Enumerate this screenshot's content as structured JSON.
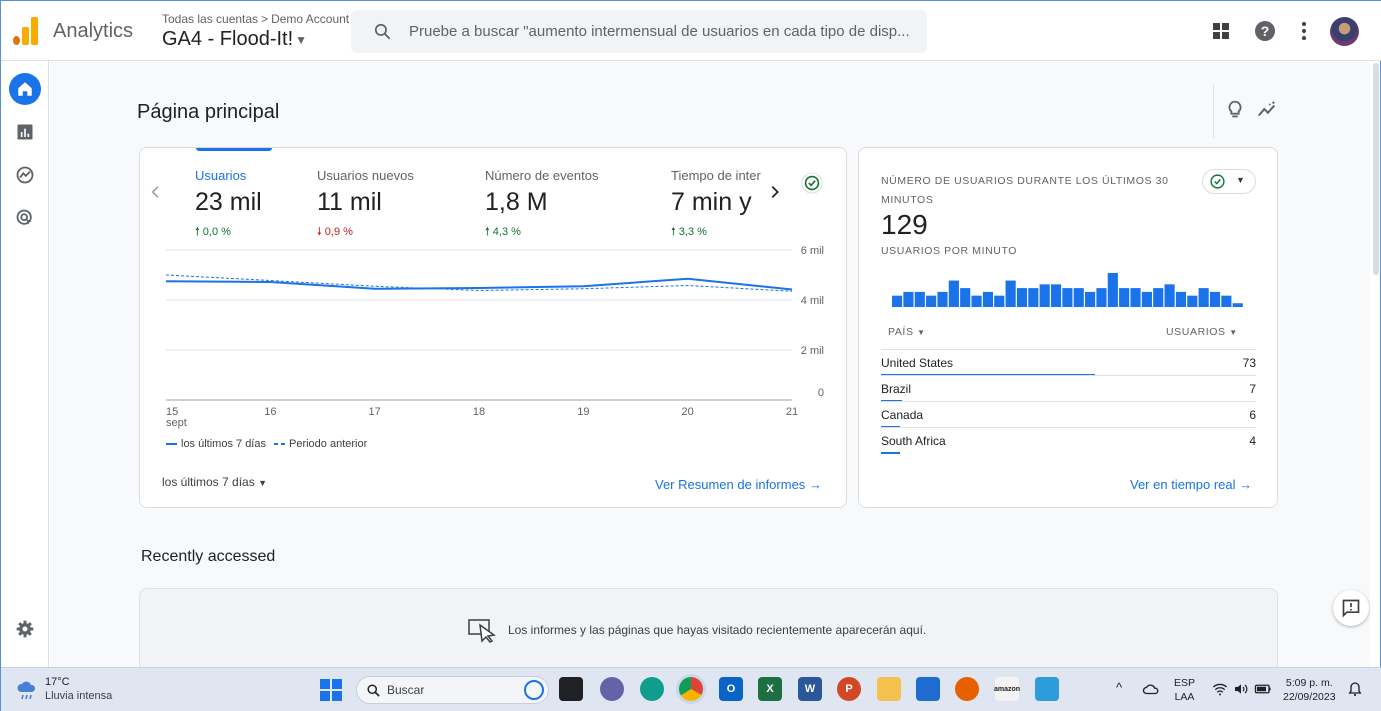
{
  "header": {
    "brand": "Analytics",
    "breadcrumb_root": "Todas las cuentas",
    "breadcrumb_sep": ">",
    "breadcrumb_account": "Demo Account",
    "property": "GA4 - Flood-It!",
    "search_placeholder": "Pruebe a buscar \"aumento intermensual de usuarios en cada tipo de disp..."
  },
  "page": {
    "title": "Página principal"
  },
  "overview": {
    "metrics": [
      {
        "label": "Usuarios",
        "value": "23 mil",
        "change": "0,0 %",
        "direction": "up"
      },
      {
        "label": "Usuarios nuevos",
        "value": "11 mil",
        "change": "0,9 %",
        "direction": "down"
      },
      {
        "label": "Número de eventos",
        "value": "1,8 M",
        "change": "4,3 %",
        "direction": "up"
      },
      {
        "label": "Tiempo de inter",
        "value": "7 min y",
        "change": "3,3 %",
        "direction": "up"
      }
    ],
    "legend_current": "los últimos 7 días",
    "legend_previous": "Periodo anterior",
    "range": "los últimos 7 días",
    "link": "Ver Resumen de informes"
  },
  "chart_data": {
    "type": "line",
    "x": [
      "15",
      "16",
      "17",
      "18",
      "19",
      "20",
      "21"
    ],
    "x_sublabel": "sept",
    "y_ticks": [
      "0",
      "2 mil",
      "4 mil",
      "6 mil"
    ],
    "ylim": [
      0,
      6000
    ],
    "series": [
      {
        "name": "los últimos 7 días",
        "values": [
          4750,
          4720,
          4450,
          4480,
          4550,
          4850,
          4420
        ],
        "style": "solid"
      },
      {
        "name": "Periodo anterior",
        "values": [
          5000,
          4780,
          4550,
          4380,
          4450,
          4580,
          4350
        ],
        "style": "dashed"
      }
    ]
  },
  "realtime": {
    "title": "NÚMERO DE USUARIOS DURANTE LOS ÚLTIMOS 30 MINUTOS",
    "value": "129",
    "subtitle": "USUARIOS POR MINUTO",
    "bars": [
      3,
      4,
      4,
      3,
      4,
      7,
      5,
      3,
      4,
      3,
      7,
      5,
      5,
      6,
      6,
      5,
      5,
      4,
      5,
      9,
      5,
      5,
      4,
      5,
      6,
      4,
      3,
      5,
      4,
      3,
      1
    ],
    "col_country": "PAÍS",
    "col_users": "USUARIOS",
    "rows": [
      {
        "country": "United States",
        "users": "73",
        "share": 1.0
      },
      {
        "country": "Brazil",
        "users": "7",
        "share": 0.096
      },
      {
        "country": "Canada",
        "users": "6",
        "share": 0.082
      },
      {
        "country": "South Africa",
        "users": "4",
        "share": 0.055
      }
    ],
    "link": "Ver en tiempo real"
  },
  "recent": {
    "title": "Recently accessed",
    "message": "Los informes y las páginas que hayas visitado recientemente aparecerán aquí."
  },
  "taskbar": {
    "temp": "17°C",
    "weather": "Lluvia intensa",
    "search": "Buscar",
    "lang1": "ESP",
    "lang2": "LAA",
    "time": "5:09 p. m.",
    "date": "22/09/2023"
  },
  "colors": {
    "accent": "#1a73e8",
    "up": "#137333",
    "down": "#c5221f",
    "logo_orange": "#f9ab00",
    "logo_dark": "#e37400"
  }
}
